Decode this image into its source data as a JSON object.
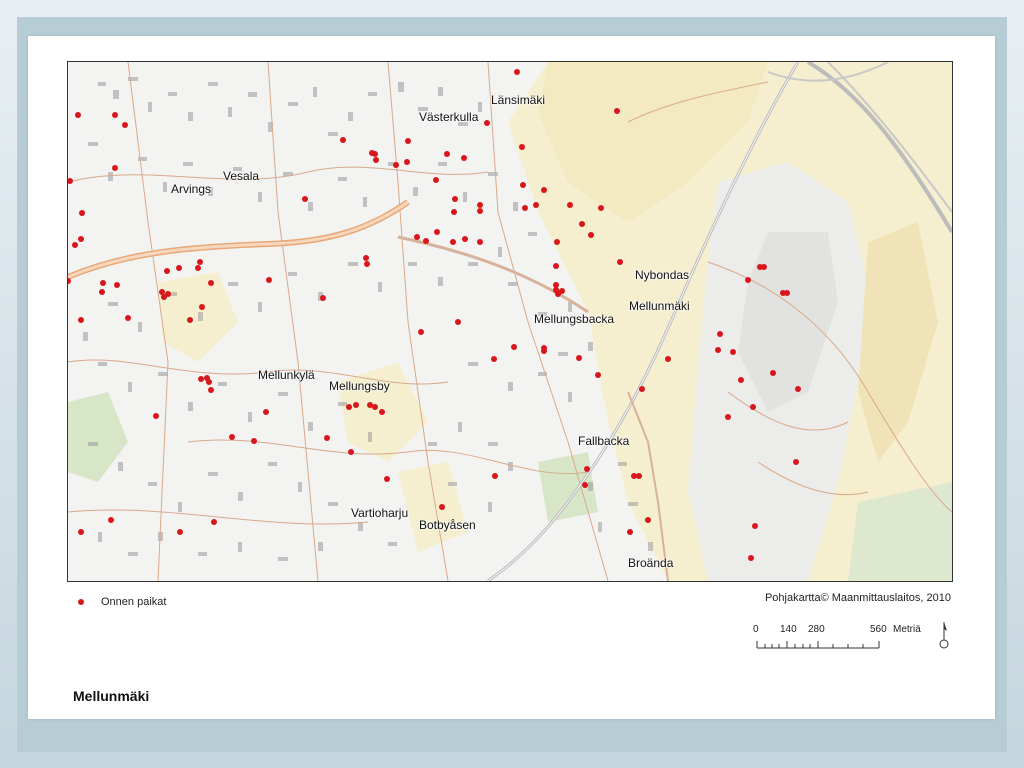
{
  "map": {
    "place_names": [
      {
        "id": "lansimaki",
        "label": "Länsimäki"
      },
      {
        "id": "vasterkulla",
        "label": "Västerkulla"
      },
      {
        "id": "vesala",
        "label": "Vesala"
      },
      {
        "id": "arvings",
        "label": "Arvings"
      },
      {
        "id": "nybondas",
        "label": "Nybondas"
      },
      {
        "id": "mellunmaki",
        "label": "Mellunmäki"
      },
      {
        "id": "mellungsbacka",
        "label": "Mellungsbacka"
      },
      {
        "id": "mellunkyla",
        "label": "Mellunkylä"
      },
      {
        "id": "mellungsby",
        "label": "Mellungsby"
      },
      {
        "id": "fallbacka",
        "label": "Fallbacka"
      },
      {
        "id": "vartioharju",
        "label": "Vartioharju"
      },
      {
        "id": "botbyasen",
        "label": "Botbyåsen"
      },
      {
        "id": "broanda",
        "label": "Broända"
      }
    ],
    "point_color": "#d8161b"
  },
  "legend": {
    "label": "Onnen paikat"
  },
  "credit": "Pohjakartta© Maanmittauslaitos,  2010",
  "scale": {
    "ticks": [
      "0",
      "140",
      "280",
      "560"
    ],
    "unit": "Metriä"
  },
  "title": "Mellunmäki"
}
